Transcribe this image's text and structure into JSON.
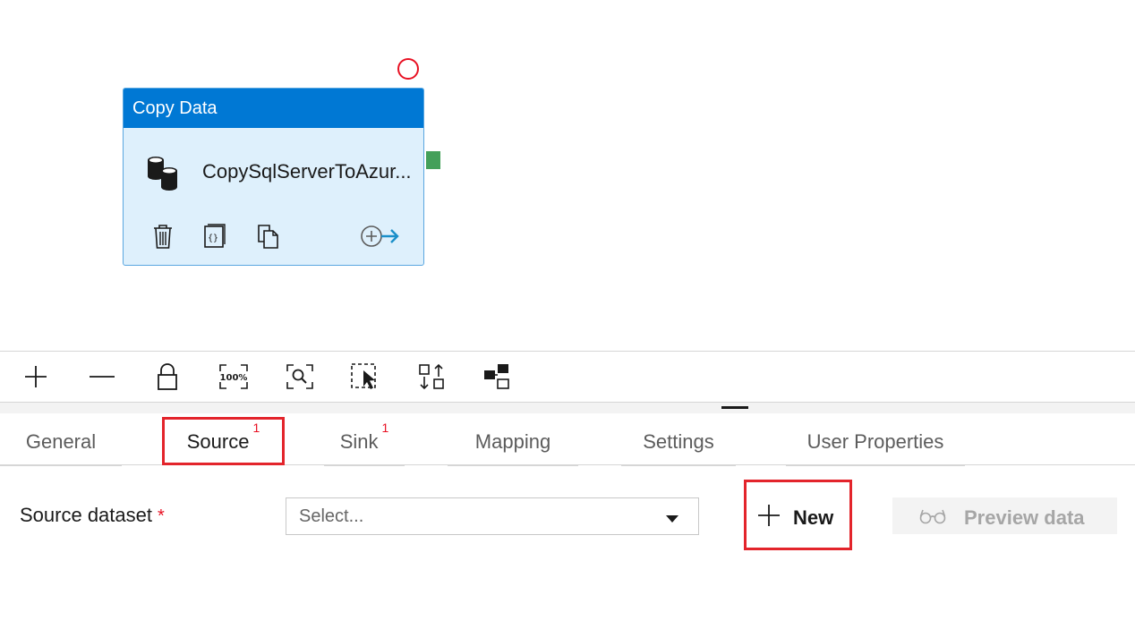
{
  "activity": {
    "type_label": "Copy Data",
    "name": "CopySqlServerToAzur..."
  },
  "tabs": [
    {
      "label": "General",
      "badge": ""
    },
    {
      "label": "Source",
      "badge": "1"
    },
    {
      "label": "Sink",
      "badge": "1"
    },
    {
      "label": "Mapping",
      "badge": ""
    },
    {
      "label": "Settings",
      "badge": ""
    },
    {
      "label": "User Properties",
      "badge": ""
    }
  ],
  "source": {
    "dataset_label": "Source dataset",
    "required_mark": "*",
    "select_value": "Select...",
    "new_label": "New",
    "preview_label": "Preview data"
  },
  "colors": {
    "accent": "#0078d4",
    "node_fill": "#def0fc",
    "success_port": "#44a05a",
    "highlight": "#e3242b",
    "badge": "#e81123"
  }
}
